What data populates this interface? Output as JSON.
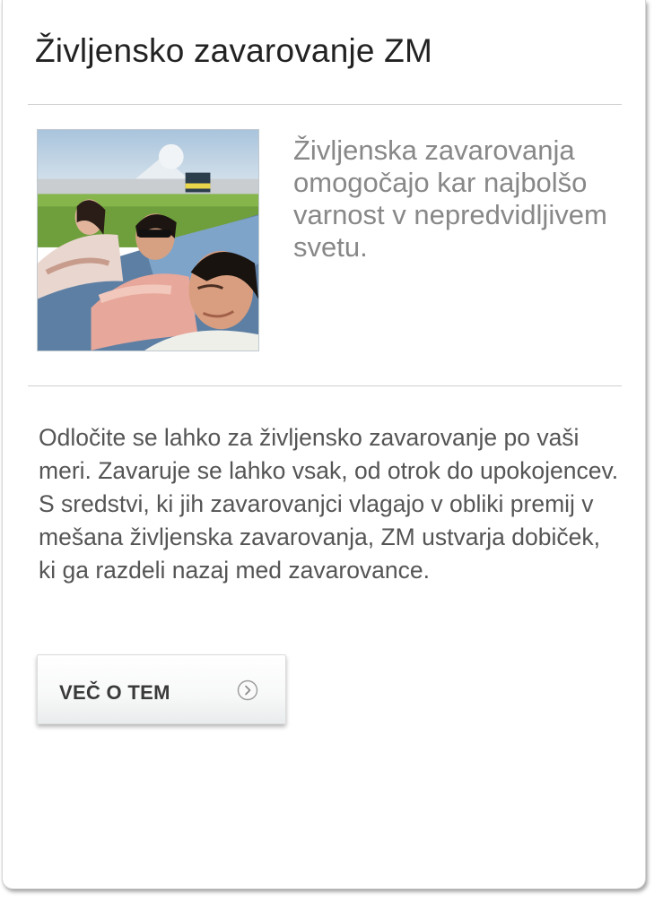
{
  "card": {
    "title": "Življensko zavarovanje ZM",
    "intro": "Življenska zavarovanja omogočajo kar najbolšo varnost v nepredvidljivem svetu.",
    "body": "Odločite se lahko za življensko zavarovanje po vaši meri. Zavaruje se lahko vsak, od otrok do upokojencev. S sredstvi, ki jih zavarovanjci vlagajo v obliki premij v mešana življenska zavarovanja, ZM ustvarja dobiček, ki ga razdeli nazaj med zavarovance.",
    "button": {
      "label": "VEČ O TEM",
      "icon": "chevron-right-circle-icon"
    },
    "photo": {
      "icon": "people-relaxing-photo"
    }
  },
  "colors": {
    "title": "#222222",
    "intro": "#888888",
    "body": "#555555",
    "divider": "#cfcfcf"
  }
}
